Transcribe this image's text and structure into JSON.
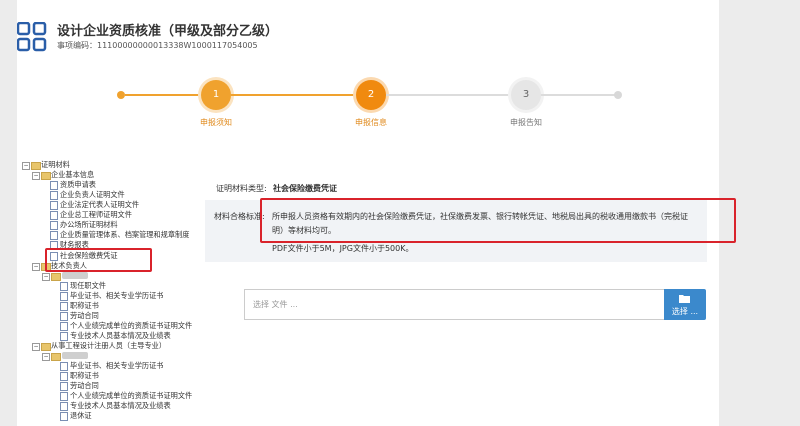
{
  "header": {
    "title": "设计企业资质核准（甲级及部分乙级）",
    "item_code": "事项编码：11100000000013338W1000117054005"
  },
  "steps": [
    {
      "number": "1",
      "label": "申报须知",
      "state": "done"
    },
    {
      "number": "2",
      "label": "申报信息",
      "state": "active"
    },
    {
      "number": "3",
      "label": "申报告知",
      "state": "pending"
    }
  ],
  "tree": {
    "root": "证明材料",
    "group1": {
      "label": "企业基本信息",
      "items": [
        "资质申请表",
        "企业负责人证明文件",
        "企业法定代表人证明文件",
        "企业总工程师证明文件",
        "办公场所证明材料",
        "企业质量管理体系、档案管理和规章制度",
        "财务报表",
        "社会保险缴费凭证"
      ]
    },
    "group2": {
      "label": "技术负责人",
      "items": [
        "现任职文件",
        "毕业证书、相关专业学历证书",
        "职称证书",
        "劳动合同",
        "个人业绩完成单位的资质证书证明文件",
        "专业技术人员基本情况及业绩表"
      ]
    },
    "group3": {
      "label": "从事工程设计注册人员（主导专业）",
      "items": [
        "毕业证书、相关专业学历证书",
        "职称证书",
        "劳动合同",
        "个人业绩完成单位的资质证书证明文件",
        "专业技术人员基本情况及业绩表",
        "退休证"
      ]
    }
  },
  "detail": {
    "type_label": "证明材料类型:",
    "type_value": "社会保险缴费凭证",
    "standard_label": "材料合格标准:",
    "standard_line1": "所申报人员资格有效期内的社会保险缴费凭证，社保缴费发票、银行转帐凭证、地税局出具的税收通用缴款书（完税证",
    "standard_line2": "明）等材料均可。",
    "size_note": "PDF文件小于5M，JPG文件小于500K。"
  },
  "upload": {
    "placeholder": "选择 文件 ...",
    "button_label": "选择 ..."
  },
  "colors": {
    "step_done": "#f0a22e",
    "step_active": "#f08a0f",
    "step_pending": "#d8d8d8",
    "highlight_red": "#d9232b",
    "button_blue": "#3b89cc"
  }
}
